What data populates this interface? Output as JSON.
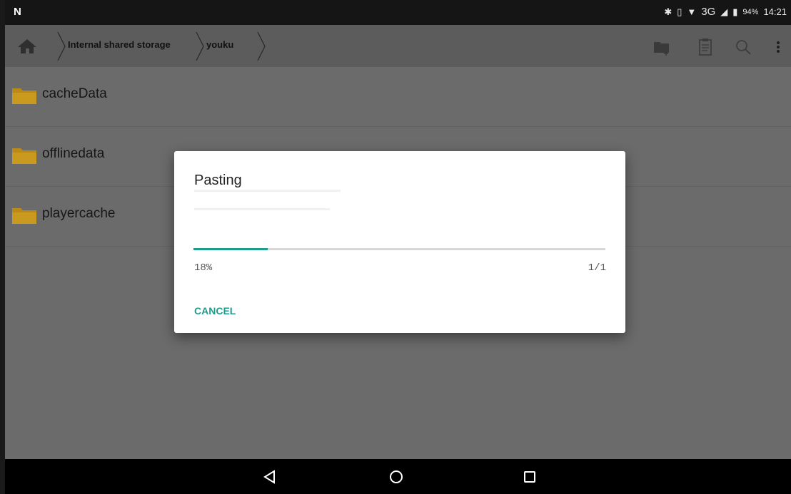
{
  "status_bar": {
    "network": "3G",
    "battery": "94%",
    "time": "14:21",
    "icons": [
      "bluetooth-icon",
      "vibrate-icon",
      "wifi-icon",
      "signal-icon",
      "battery-icon"
    ]
  },
  "toolbar": {
    "breadcrumbs": [
      "Internal shared storage",
      "youku"
    ],
    "actions": [
      "new-folder-icon",
      "clipboard-icon",
      "search-icon",
      "more-vert-icon"
    ]
  },
  "files": [
    {
      "name": "cacheData"
    },
    {
      "name": "offlinedata"
    },
    {
      "name": "playercache"
    }
  ],
  "dialog": {
    "title": "Pasting",
    "progress_label": "18%",
    "progress_fraction": 0.18,
    "count": "1/1",
    "cancel_label": "CANCEL"
  },
  "colors": {
    "accent": "#1f9d8c",
    "toolbar": "#5c5c5c",
    "scrim_background": "#6b6b6b",
    "folder": "#c99a1e"
  }
}
